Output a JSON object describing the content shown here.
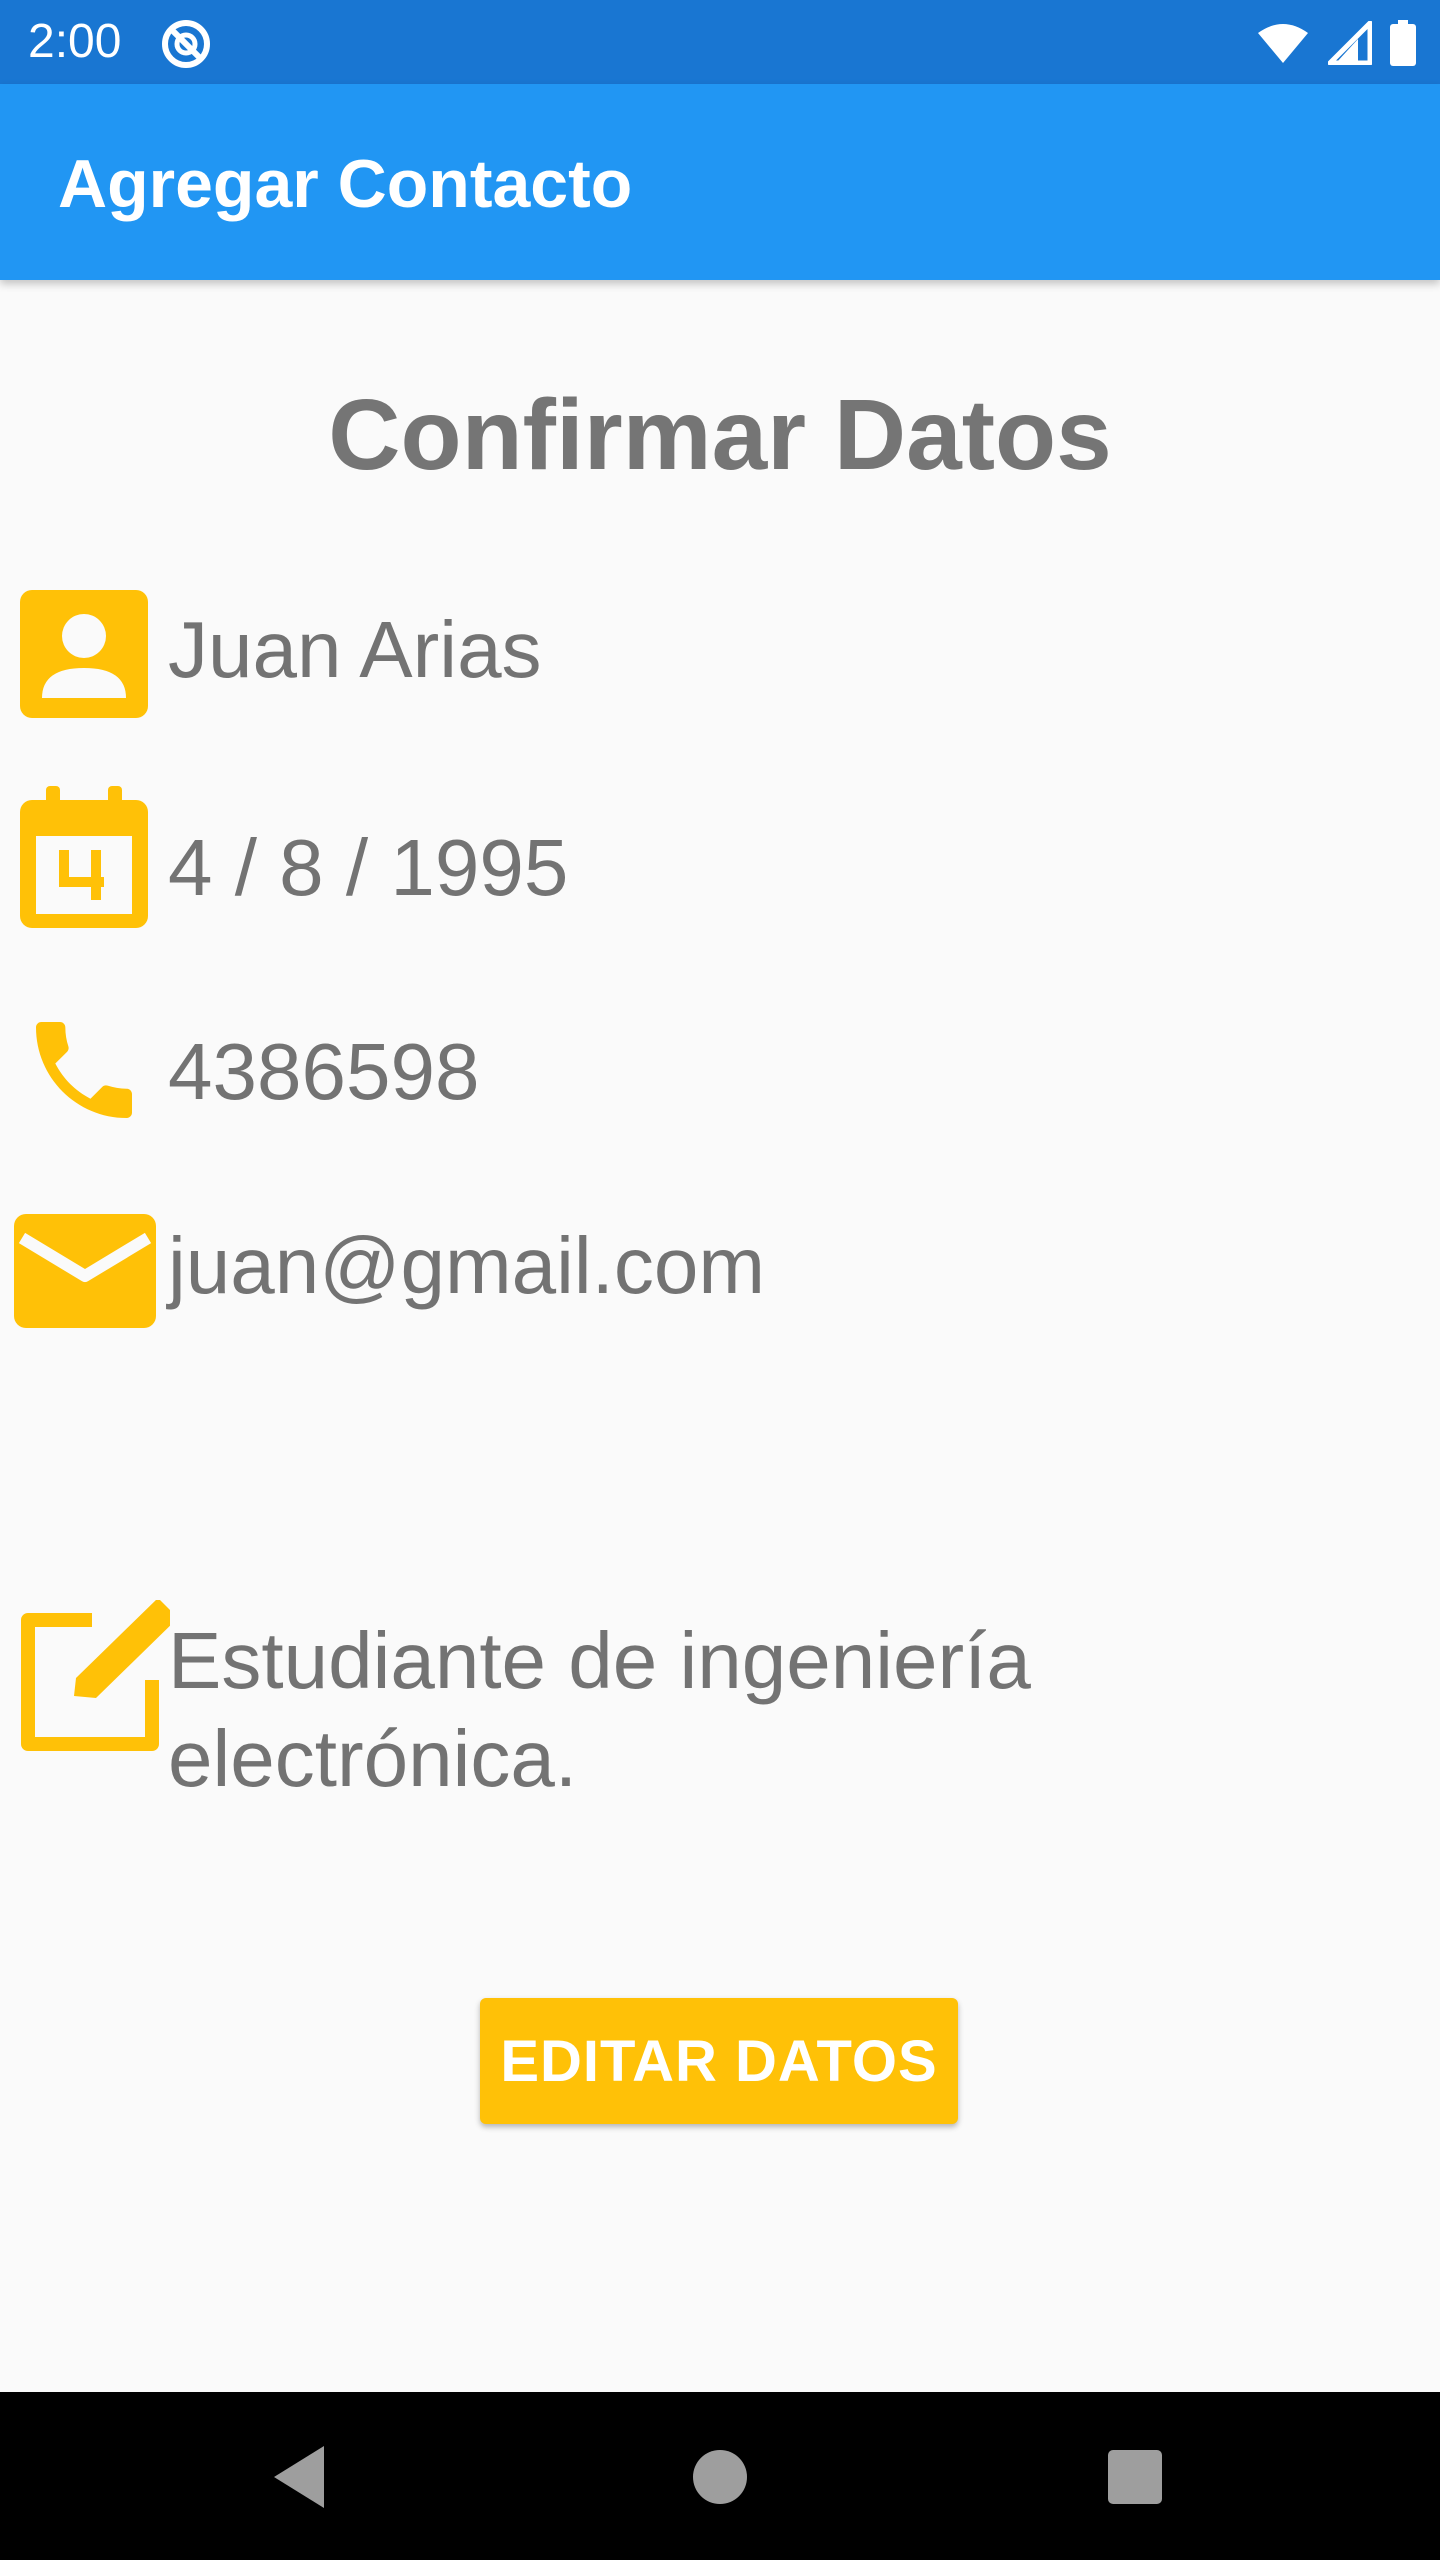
{
  "status_bar": {
    "time": "2:00",
    "icons": [
      "sync-icon",
      "wifi-icon",
      "signal-icon",
      "battery-icon"
    ]
  },
  "app_bar": {
    "title": "Agregar Contacto"
  },
  "main": {
    "heading": "Confirmar Datos",
    "fields": [
      {
        "icon": "contact-icon",
        "value": "Juan Arias"
      },
      {
        "icon": "calendar-icon",
        "value": "4 / 8 / 1995"
      },
      {
        "icon": "phone-icon",
        "value": "4386598"
      },
      {
        "icon": "email-icon",
        "value": "juan@gmail.com"
      }
    ],
    "description": {
      "icon": "edit-note-icon",
      "value": "Estudiante de ingeniería electrónica."
    },
    "edit_button_label": "EDITAR DATOS"
  },
  "nav_bar": {
    "icons": [
      "back-icon",
      "home-icon",
      "recents-icon"
    ]
  },
  "colors": {
    "status_bar": "#1976d2",
    "app_bar": "#2196f3",
    "accent": "#ffc107",
    "text": "#737373",
    "background": "#fafafa"
  }
}
